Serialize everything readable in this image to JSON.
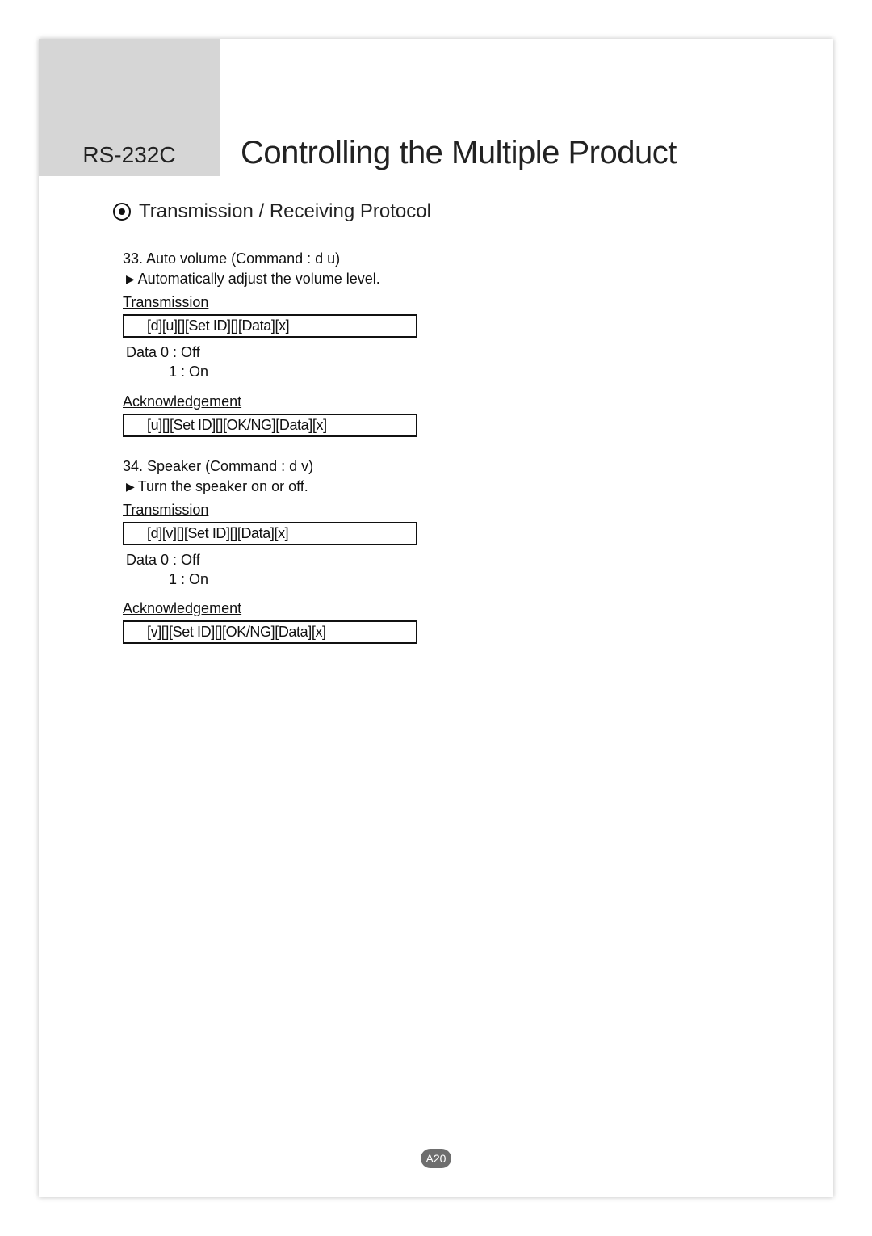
{
  "header": {
    "label": "RS-232C",
    "title": "Controlling the Multiple Product"
  },
  "section": {
    "title": "Transmission / Receiving Protocol"
  },
  "commands": [
    {
      "title": "33. Auto volume (Command : d u)",
      "desc": "Automatically adjust the volume level.",
      "transmission_label": "Transmission",
      "transmission_syntax": "[d][u][][Set ID][][Data][x]",
      "data_line1": "Data 0 : Off",
      "data_line2": "1 : On",
      "ack_label": "Acknowledgement",
      "ack_syntax": "[u][][Set ID][][OK/NG][Data][x]"
    },
    {
      "title": "34. Speaker (Command : d v)",
      "desc": "Turn the speaker on or off.",
      "transmission_label": "Transmission",
      "transmission_syntax": "[d][v][][Set ID][][Data][x]",
      "data_line1": "Data 0 : Off",
      "data_line2": "1 : On",
      "ack_label": "Acknowledgement",
      "ack_syntax": "[v][][Set ID][][OK/NG][Data][x]"
    }
  ],
  "page_number": "A20"
}
